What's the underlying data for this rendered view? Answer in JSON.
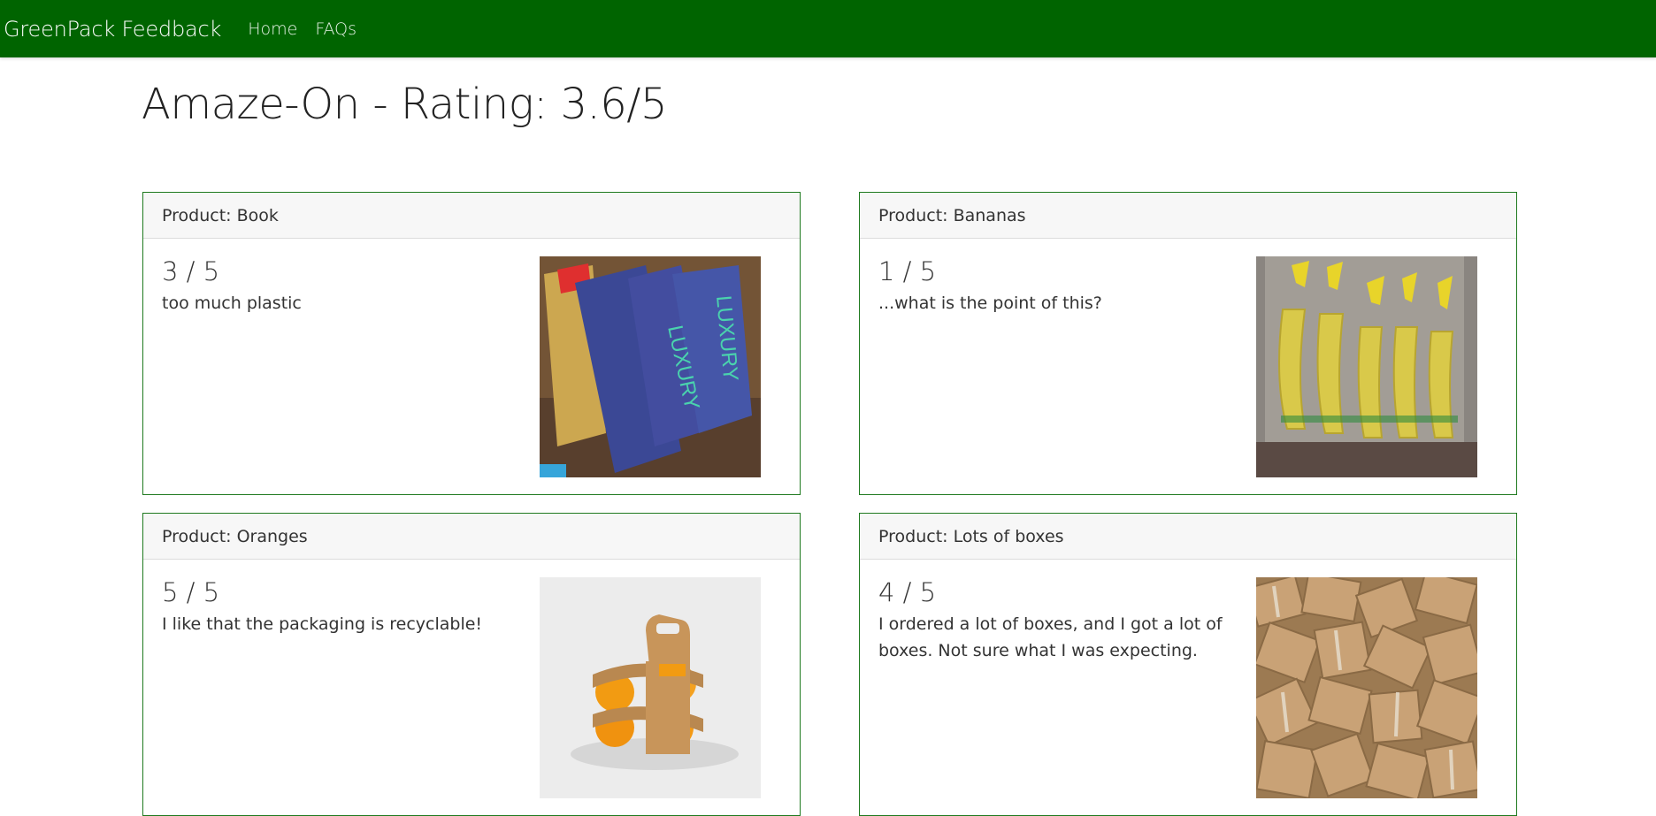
{
  "nav": {
    "brand": "GreenPack Feedback",
    "links": [
      "Home",
      "FAQs"
    ]
  },
  "page": {
    "title": "Amaze-On - Rating: 3.6/5"
  },
  "reviews": [
    {
      "product": "Product: Book",
      "score": "3 / 5",
      "comment": "too much plastic",
      "image": "book-packaging-image"
    },
    {
      "product": "Product: Bananas",
      "score": "1 / 5",
      "comment": "...what is the point of this?",
      "image": "bananas-packaging-image"
    },
    {
      "product": "Product: Oranges",
      "score": "5 / 5",
      "comment": "I like that the packaging is recyclable!",
      "image": "oranges-packaging-image"
    },
    {
      "product": "Product: Lots of boxes",
      "score": "4 / 5",
      "comment": "I ordered a lot of boxes, and I got a lot of boxes. Not sure what I was expecting.",
      "image": "boxes-image"
    }
  ],
  "colors": {
    "navbar": "#006400",
    "card_border": "#1f7a1f",
    "header_bg": "#f7f7f7"
  }
}
